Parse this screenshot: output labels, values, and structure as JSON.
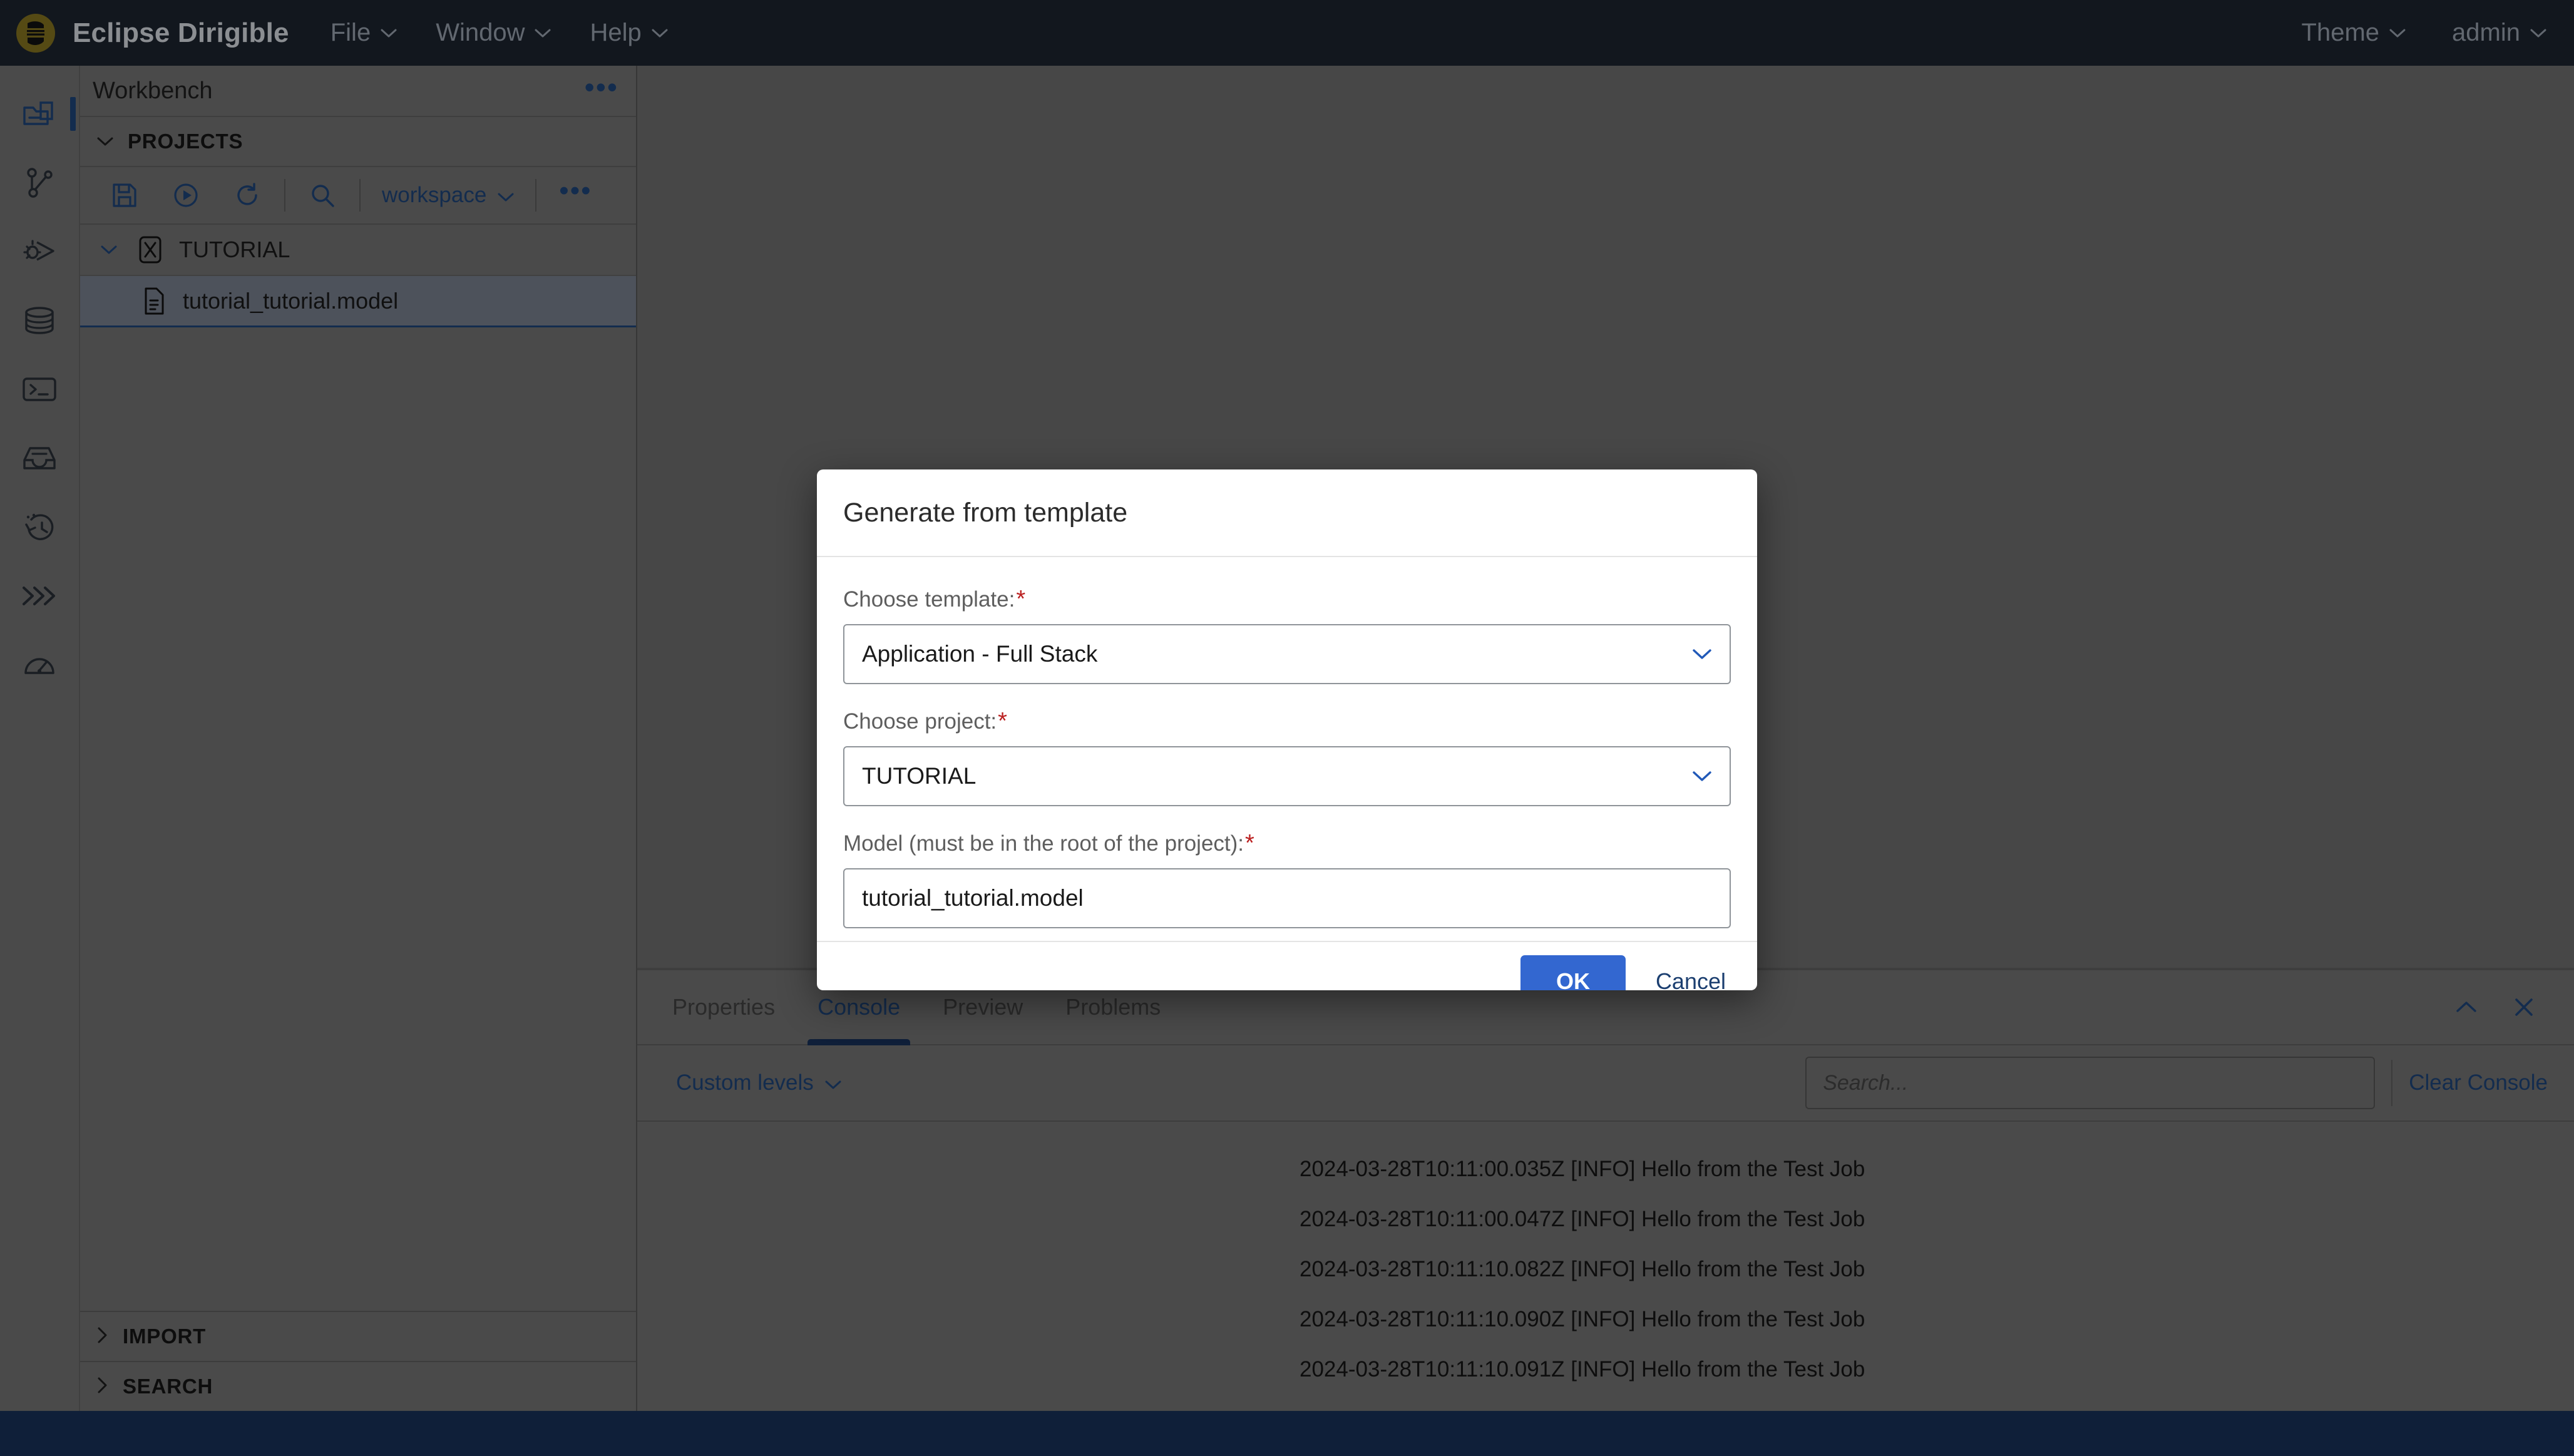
{
  "topbar": {
    "brand": "Eclipse Dirigible",
    "logo_icon": "dirigible-logo-icon",
    "menus": [
      {
        "label": "File",
        "icon": "chevron-down-icon"
      },
      {
        "label": "Window",
        "icon": "chevron-down-icon"
      },
      {
        "label": "Help",
        "icon": "chevron-down-icon"
      }
    ],
    "right_menus": [
      {
        "label": "Theme",
        "icon": "chevron-down-icon"
      },
      {
        "label": "admin",
        "icon": "chevron-down-icon"
      }
    ]
  },
  "rail": {
    "items": [
      {
        "name": "workbench",
        "icon": "workbench-icon",
        "active": true
      },
      {
        "name": "git",
        "icon": "git-branch-icon",
        "active": false
      },
      {
        "name": "debugger",
        "icon": "debug-icon",
        "active": false
      },
      {
        "name": "database",
        "icon": "database-icon",
        "active": false
      },
      {
        "name": "terminal",
        "icon": "terminal-icon",
        "active": false
      },
      {
        "name": "repository",
        "icon": "inbox-icon",
        "active": false
      },
      {
        "name": "jobs",
        "icon": "history-icon",
        "active": false
      },
      {
        "name": "flows",
        "icon": "chevrons-right-icon",
        "active": false
      },
      {
        "name": "monitoring",
        "icon": "gauge-icon",
        "active": false
      }
    ]
  },
  "explorer": {
    "panel_title": "Workbench",
    "panel_more_icon": "more-horizontal-icon",
    "projects_section": {
      "label": "PROJECTS",
      "twisty_icon": "chevron-down-icon",
      "toolbar": {
        "buttons": [
          {
            "name": "save",
            "icon": "save-icon"
          },
          {
            "name": "publish",
            "icon": "play-circle-icon"
          },
          {
            "name": "refresh",
            "icon": "refresh-icon"
          },
          {
            "name": "search",
            "icon": "search-icon"
          }
        ],
        "workspace_label": "workspace",
        "workspace_caret_icon": "chevron-down-icon",
        "more_icon": "more-horizontal-icon"
      },
      "tree": [
        {
          "label": "TUTORIAL",
          "twisty_icon": "chevron-down-icon",
          "icon": "project-icon",
          "selected": false,
          "indent": false
        },
        {
          "label": "tutorial_tutorial.model",
          "twisty_icon": "",
          "icon": "model-file-icon",
          "selected": true,
          "indent": true
        }
      ]
    },
    "collapsed_sections": [
      {
        "label": "IMPORT",
        "twisty_icon": "chevron-right-icon"
      },
      {
        "label": "SEARCH",
        "twisty_icon": "chevron-right-icon"
      }
    ]
  },
  "bottom_panel": {
    "tabs": [
      {
        "label": "Properties",
        "active": false
      },
      {
        "label": "Console",
        "active": true
      },
      {
        "label": "Preview",
        "active": false
      },
      {
        "label": "Problems",
        "active": false
      }
    ],
    "actions": [
      {
        "name": "collapse-panel",
        "icon": "chevron-up-icon"
      },
      {
        "name": "close-panel",
        "icon": "close-icon"
      }
    ],
    "console": {
      "levels_label": "Custom levels",
      "levels_caret_icon": "chevron-down-icon",
      "search_placeholder": "Search...",
      "search_value": "",
      "clear_label": "Clear Console",
      "log_lines": [
        "2024-03-28T10:11:00.035Z [INFO] Hello from the Test Job",
        "2024-03-28T10:11:00.047Z [INFO] Hello from the Test Job",
        "2024-03-28T10:11:10.082Z [INFO] Hello from the Test Job",
        "2024-03-28T10:11:10.090Z [INFO] Hello from the Test Job",
        "2024-03-28T10:11:10.091Z [INFO] Hello from the Test Job"
      ]
    }
  },
  "modal": {
    "title": "Generate from template",
    "fields": [
      {
        "label": "Choose template:",
        "required_mark": "*",
        "value": "Application - Full Stack",
        "type": "select",
        "caret_icon": "chevron-down-icon"
      },
      {
        "label": "Choose project:",
        "required_mark": "*",
        "value": "TUTORIAL",
        "type": "select",
        "caret_icon": "chevron-down-icon"
      },
      {
        "label": "Model (must be in the root of the project):",
        "required_mark": "*",
        "value": "tutorial_tutorial.model",
        "type": "text",
        "caret_icon": ""
      }
    ],
    "ok_label": "OK",
    "cancel_label": "Cancel"
  },
  "colors": {
    "topbar_bg": "#1b212c",
    "app_bg": "#6a6a6a",
    "accent_navy": "#1c3f70",
    "statusbar_bg": "#162d52",
    "primary_button": "#3367d0",
    "required_red": "#bb2020",
    "logo_gold": "#7a6a1d"
  }
}
